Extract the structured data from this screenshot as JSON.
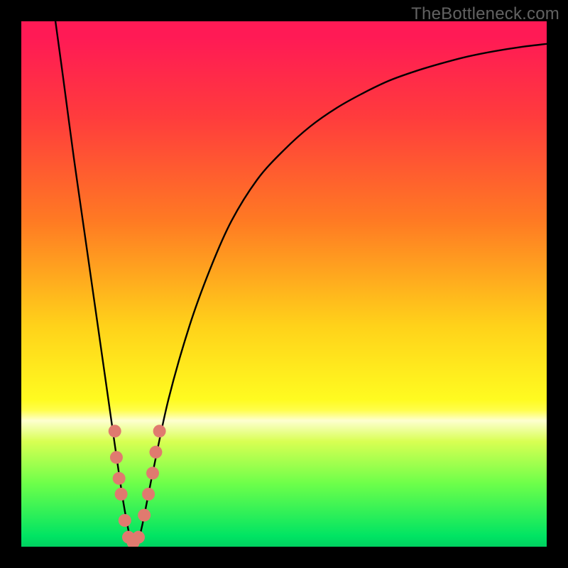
{
  "watermark": "TheBottleneck.com",
  "colors": {
    "frame": "#000000",
    "gradient_top": "#ff1a55",
    "gradient_bottom": "#00d060",
    "curve": "#000000",
    "dot": "#e07a6f"
  },
  "chart_data": {
    "type": "line",
    "title": "",
    "xlabel": "",
    "ylabel": "",
    "xlim": [
      0,
      100
    ],
    "ylim": [
      0,
      100
    ],
    "x": [
      6.5,
      8,
      10,
      12,
      14,
      16,
      18,
      19.5,
      21,
      22,
      23,
      25,
      28,
      32,
      36,
      40,
      45,
      50,
      55,
      60,
      65,
      70,
      75,
      80,
      85,
      90,
      95,
      100
    ],
    "values": [
      100,
      89,
      74,
      60,
      46,
      32,
      18,
      8,
      0.5,
      0.5,
      4,
      14,
      28,
      42,
      53,
      62,
      70,
      75.5,
      80,
      83.5,
      86.3,
      88.7,
      90.5,
      92,
      93.3,
      94.3,
      95.1,
      95.7
    ],
    "minimum_x": 21,
    "scatter_points": [
      {
        "x": 17.8,
        "y": 22
      },
      {
        "x": 18.1,
        "y": 17
      },
      {
        "x": 18.6,
        "y": 13
      },
      {
        "x": 19.0,
        "y": 10
      },
      {
        "x": 19.7,
        "y": 5
      },
      {
        "x": 20.4,
        "y": 1.8
      },
      {
        "x": 21.3,
        "y": 0.8
      },
      {
        "x": 22.3,
        "y": 1.8
      },
      {
        "x": 23.4,
        "y": 6
      },
      {
        "x": 24.2,
        "y": 10
      },
      {
        "x": 25.0,
        "y": 14
      },
      {
        "x": 25.6,
        "y": 18
      },
      {
        "x": 26.3,
        "y": 22
      }
    ]
  }
}
